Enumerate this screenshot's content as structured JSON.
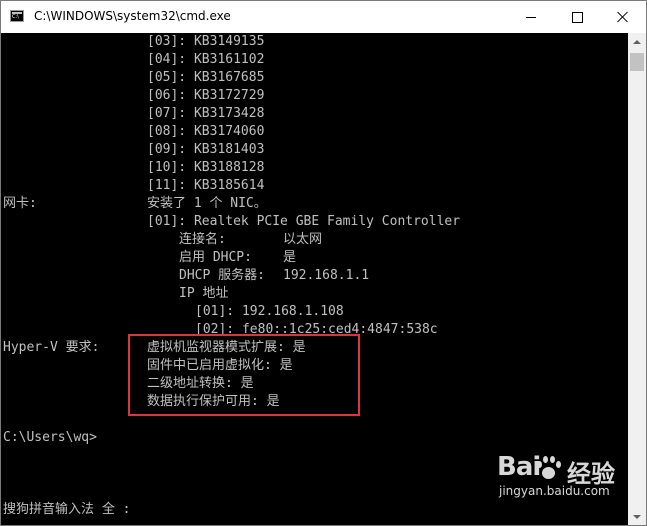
{
  "window": {
    "title": "C:\\WINDOWS\\system32\\cmd.exe"
  },
  "console": {
    "hotfixes": [
      "[03]: KB3149135",
      "[04]: KB3161102",
      "[05]: KB3167685",
      "[06]: KB3172729",
      "[07]: KB3173428",
      "[08]: KB3174060",
      "[09]: KB3181403",
      "[10]: KB3188128",
      "[11]: KB3185614"
    ],
    "nic_label": "网卡:",
    "nic_summary": "安装了 1 个 NIC。",
    "nic_name": "[01]: Realtek PCIe GBE Family Controller",
    "connection_name_label": "连接名:",
    "connection_name_value": "以太网",
    "dhcp_enabled_label": "启用 DHCP:",
    "dhcp_enabled_value": "是",
    "dhcp_server_label": "DHCP 服务器:",
    "dhcp_server_value": "192.168.1.1",
    "ip_label": "IP 地址",
    "ip_addresses": [
      "[01]: 192.168.1.108",
      "[02]: fe80::1c25:ced4:4847:538c"
    ],
    "hyperv_label": "Hyper-V 要求:",
    "hyperv_requirements": [
      "虚拟机监视器模式扩展: 是",
      "固件中已启用虚拟化: 是",
      "二级地址转换: 是",
      "数据执行保护可用: 是"
    ],
    "prompt": "C:\\Users\\wq>",
    "ime_status": "搜狗拼音输入法 全 :"
  },
  "watermark": {
    "brand_prefix": "Bai",
    "brand_suffix": "经验",
    "url": "jingyan.baidu.com"
  },
  "colors": {
    "console_background": "#000000",
    "console_text": "#c0c0c0",
    "highlight_border": "#d9363e"
  }
}
